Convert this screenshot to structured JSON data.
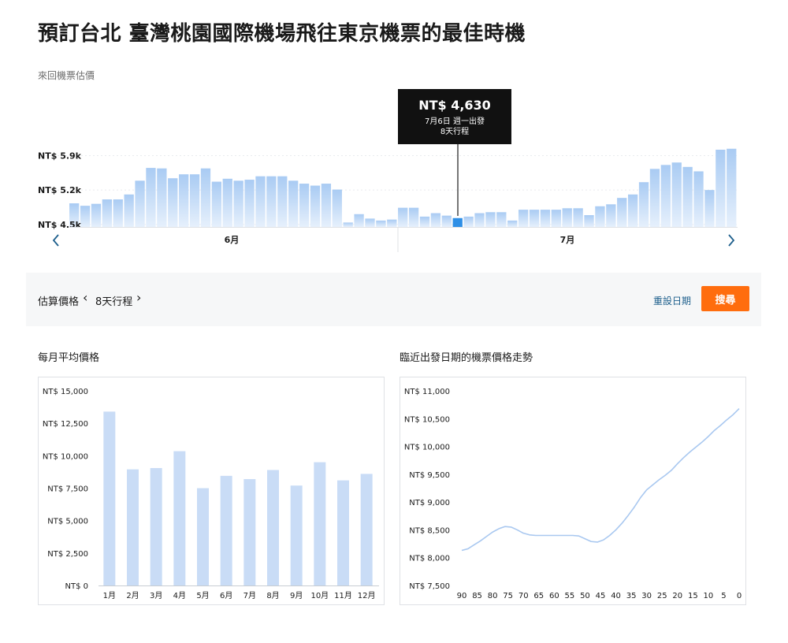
{
  "page": {
    "title": "預訂台北 臺灣桃園國際機場飛往東京機票的最佳時機",
    "subtitle": "來回機票估價"
  },
  "tooltip": {
    "price": "NT$ 4,630",
    "line1": "7月6日 週一出發",
    "line2": "8天行程"
  },
  "panel": {
    "label": "估算價格",
    "trip": "8天行程",
    "reset": "重設日期",
    "search": "搜尋"
  },
  "sections": {
    "monthly_title": "每月平均價格",
    "trend_title": "臨近出發日期的機票價格走勢"
  },
  "chart_data": [
    {
      "type": "bar",
      "y_ticks": [
        "NT$ 4.5k",
        "NT$ 5.2k",
        "NT$ 5.9k"
      ],
      "ylim": [
        4450,
        6100
      ],
      "months": [
        "6月",
        "7月"
      ],
      "highlight_index": 35,
      "colors": {
        "bar": "#c5dcf6",
        "highlight": "#2e8fe6"
      },
      "values": [
        4930,
        4880,
        4920,
        5010,
        5010,
        5110,
        5390,
        5650,
        5640,
        5440,
        5520,
        5520,
        5640,
        5370,
        5430,
        5390,
        5410,
        5480,
        5480,
        5480,
        5390,
        5330,
        5290,
        5330,
        5210,
        4540,
        4710,
        4620,
        4580,
        4600,
        4840,
        4840,
        4660,
        4730,
        4680,
        4630,
        4660,
        4730,
        4750,
        4750,
        4580,
        4800,
        4800,
        4800,
        4800,
        4830,
        4830,
        4690,
        4870,
        4910,
        5040,
        5110,
        5360,
        5630,
        5710,
        5760,
        5670,
        5580,
        5200,
        6020,
        6040
      ]
    },
    {
      "type": "bar",
      "categories": [
        "1月",
        "2月",
        "3月",
        "4月",
        "5月",
        "6月",
        "7月",
        "8月",
        "9月",
        "10月",
        "11月",
        "12月"
      ],
      "values": [
        13400,
        8950,
        9050,
        10350,
        7500,
        8450,
        8200,
        8900,
        7700,
        9500,
        8100,
        8600
      ],
      "y_ticks": [
        "NT$ 0",
        "NT$ 2,500",
        "NT$ 5,000",
        "NT$ 7,500",
        "NT$ 10,000",
        "NT$ 12,500",
        "NT$ 15,000"
      ],
      "ylim": [
        0,
        15000
      ],
      "colors": {
        "bar": "#c9dcf6"
      }
    },
    {
      "type": "line",
      "x_ticks": [
        "90",
        "85",
        "80",
        "75",
        "70",
        "65",
        "60",
        "55",
        "50",
        "45",
        "40",
        "35",
        "30",
        "25",
        "20",
        "15",
        "10",
        "5",
        "0"
      ],
      "y_ticks": [
        "NT$ 7,500",
        "NT$ 8,000",
        "NT$ 8,500",
        "NT$ 9,000",
        "NT$ 9,500",
        "NT$ 10,000",
        "NT$ 10,500",
        "NT$ 11,000"
      ],
      "xlim": [
        90,
        0
      ],
      "ylim": [
        7500,
        11000
      ],
      "x": [
        90,
        88,
        86,
        84,
        82,
        80,
        78,
        76,
        74,
        72,
        70,
        68,
        66,
        64,
        62,
        60,
        58,
        56,
        54,
        52,
        50,
        48,
        46,
        44,
        42,
        40,
        38,
        36,
        34,
        32,
        30,
        28,
        26,
        24,
        22,
        20,
        18,
        16,
        14,
        12,
        10,
        8,
        6,
        4,
        2,
        0
      ],
      "values": [
        8130,
        8160,
        8230,
        8300,
        8380,
        8460,
        8520,
        8560,
        8550,
        8500,
        8440,
        8410,
        8400,
        8400,
        8400,
        8400,
        8400,
        8400,
        8400,
        8390,
        8340,
        8290,
        8280,
        8320,
        8400,
        8500,
        8620,
        8760,
        8910,
        9080,
        9220,
        9310,
        9400,
        9480,
        9570,
        9690,
        9800,
        9900,
        9990,
        10080,
        10180,
        10290,
        10380,
        10480,
        10570,
        10680
      ],
      "colors": {
        "line": "#a9c8f0"
      }
    }
  ]
}
